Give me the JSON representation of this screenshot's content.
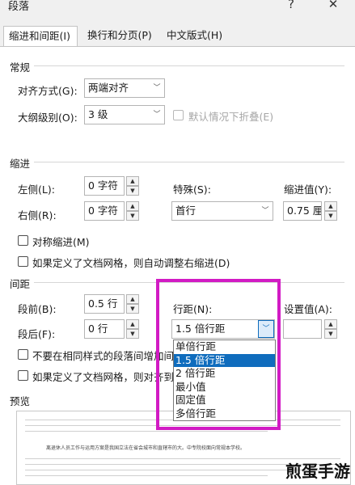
{
  "window": {
    "title": "段落",
    "help": "?",
    "close": "✕"
  },
  "tabs": [
    {
      "label": "缩进和间距(I)",
      "active": true
    },
    {
      "label": "换行和分页(P)",
      "active": false
    },
    {
      "label": "中文版式(H)",
      "active": false
    }
  ],
  "general": {
    "heading": "常规",
    "alignment": {
      "label": "对齐方式(G):",
      "value": "两端对齐"
    },
    "outline": {
      "label": "大纲级别(O):",
      "value": "3 级"
    },
    "collapsed_default": {
      "label": "默认情况下折叠(E)",
      "checked": false,
      "enabled": false
    }
  },
  "indentation": {
    "heading": "缩进",
    "left": {
      "label": "左侧(L):",
      "value": "0 字符"
    },
    "right": {
      "label": "右侧(R):",
      "value": "0 字符"
    },
    "special": {
      "label": "特殊(S):",
      "value": "首行"
    },
    "by": {
      "label": "缩进值(Y):",
      "value": "0.75 厘米"
    },
    "mirror": {
      "label": "对称缩进(M)",
      "checked": false
    },
    "auto_adjust": {
      "label": "如果定义了文档网格，则自动调整右缩进(D)",
      "checked": false
    }
  },
  "spacing": {
    "heading": "间距",
    "before": {
      "label": "段前(B):",
      "value": "0.5 行"
    },
    "after": {
      "label": "段后(F):",
      "value": "0 行"
    },
    "line_spacing": {
      "label": "行距(N):",
      "value": "1.5 倍行距"
    },
    "at": {
      "label": "设置值(A):",
      "value": ""
    },
    "no_space_same_style": {
      "label": "不要在相同样式的段落间增加间",
      "checked": false
    },
    "snap_grid": {
      "label": "如果定义了文档网格，则对齐到",
      "checked": false
    }
  },
  "line_spacing_menu": {
    "options": [
      "单倍行距",
      "1.5 倍行距",
      "2 倍行距",
      "最小值",
      "固定值",
      "多倍行距"
    ],
    "selected_index": 1
  },
  "preview": {
    "heading": "预览",
    "sample_text": "离退休人员工作与运用方案是我国立法在省会城市和直辖市的大。中专院校面向常规本学校。"
  },
  "watermark": "煎蛋手游",
  "colors": {
    "highlight": "#d21bc4",
    "menu_selection": "#0f6cbd"
  }
}
